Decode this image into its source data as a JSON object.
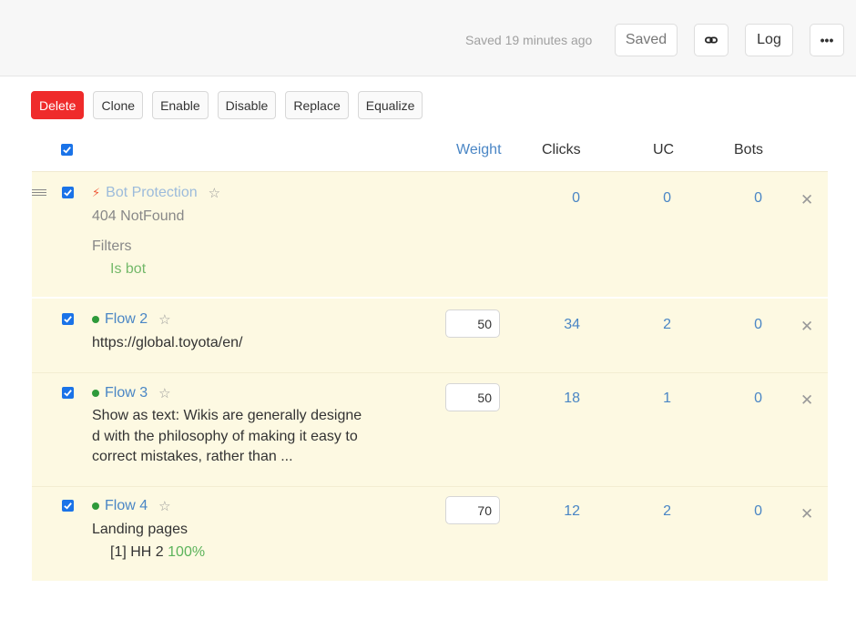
{
  "header": {
    "saved_time": "Saved 19 minutes ago",
    "saved_label": "Saved",
    "log_label": "Log",
    "more_label": "•••"
  },
  "actions": {
    "delete": "Delete",
    "clone": "Clone",
    "enable": "Enable",
    "disable": "Disable",
    "replace": "Replace",
    "equalize": "Equalize"
  },
  "columns": {
    "weight": "Weight",
    "clicks": "Clicks",
    "uc": "UC",
    "bots": "Bots"
  },
  "colors": {
    "accent": "#4a86c5",
    "danger": "#ef2b2b",
    "row_bg": "#fdf9e2",
    "active_dot": "#2e9a3a"
  },
  "flows": [
    {
      "name": "Bot Protection",
      "icon": "bolt-icon",
      "subtitle": "404 NotFound",
      "filters_label": "Filters",
      "filter": "Is bot",
      "clicks": "0",
      "uc": "0",
      "bots": "0"
    },
    {
      "name": "Flow 2",
      "url": "https://global.toyota/en/",
      "weight": "50",
      "clicks": "34",
      "uc": "2",
      "bots": "0"
    },
    {
      "name": "Flow 3",
      "description": "Show as text: Wikis are generally designed with the philosophy of making it easy to correct mistakes, rather than ...",
      "weight": "50",
      "clicks": "18",
      "uc": "1",
      "bots": "0"
    },
    {
      "name": "Flow 4",
      "subtitle": "Landing pages",
      "landing": "[1] HH 2",
      "landing_pct": "100%",
      "weight": "70",
      "clicks": "12",
      "uc": "2",
      "bots": "0"
    }
  ]
}
